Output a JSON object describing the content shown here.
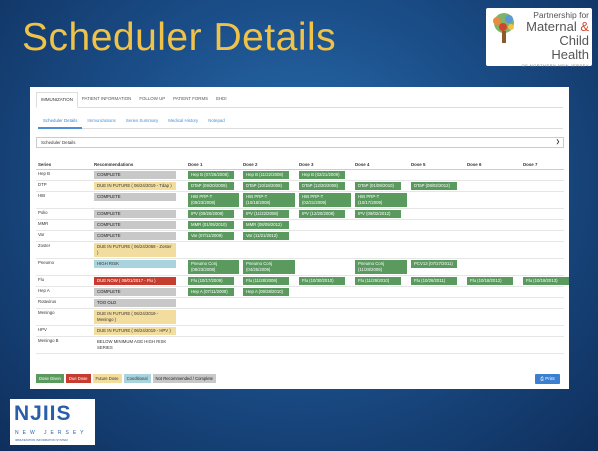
{
  "slide": {
    "title": "Scheduler Details"
  },
  "logo_pmch": {
    "line1": "Partnership for",
    "line2a": "Maternal ",
    "amp": "&",
    "line3": "Child Health",
    "line4": "OF NORTHERN NEW JERSEY"
  },
  "logo_njiis": {
    "title": "NJIIS",
    "sub": "NEW JERSEY",
    "small": "IMMUNIZATION INFORMATION SYSTEM"
  },
  "top_tabs": [
    "IMMUNIZATION",
    "PATIENT INFORMATION",
    "FOLLOW UP",
    "PATIENT FORMS",
    "EHDI"
  ],
  "sub_tabs": [
    "Scheduler Details",
    "Immunizations",
    "Series Summary",
    "Medical History",
    "Notepad"
  ],
  "dropdown": {
    "value": "Scheduler Details"
  },
  "table": {
    "headers": [
      "Series",
      "Recommendations",
      "Dose 1",
      "Dose 2",
      "Dose 3",
      "Dose 4",
      "Dose 5",
      "Dose 6",
      "Dose 7"
    ],
    "rows": [
      {
        "series": "Hep B",
        "rec": "COMPLETE",
        "rec_color": "gray",
        "doses": [
          "Hep B (07/26/2008)",
          "Hep B (11/22/2008)",
          "Hep B (02/21/2009)",
          "",
          "",
          "",
          ""
        ],
        "dose_colors": [
          "green",
          "green",
          "green",
          "",
          "",
          "",
          ""
        ]
      },
      {
        "series": "DTP",
        "rec": "DUE IN FUTURE ( 06/24/2019 - Tdap )",
        "rec_color": "yellow",
        "doses": [
          "DTaP (09/20/2008)",
          "DTaP (10/18/2008)",
          "DTaP (12/20/2008)",
          "DTaP (01/09/2010)",
          "DTaP (08/02/2012)",
          "",
          ""
        ],
        "dose_colors": [
          "green",
          "green",
          "green",
          "green",
          "green",
          "",
          ""
        ]
      },
      {
        "series": "HIB",
        "rec": "COMPLETE",
        "rec_color": "gray",
        "doses": [
          "HIB PRP-T (09/23/2008)",
          "HIB PRP-T (10/18/2008)",
          "HIB PRP-T (02/21/2009)",
          "HIB PRP-T (10/17/2009)",
          "",
          "",
          ""
        ],
        "dose_colors": [
          "green",
          "green",
          "green",
          "green",
          "",
          "",
          ""
        ]
      },
      {
        "series": "Polio",
        "rec": "COMPLETE",
        "rec_color": "gray",
        "doses": [
          "IPV (09/20/2008)",
          "IPV (11/22/2008)",
          "IPV (12/20/2008)",
          "IPV (08/02/2012)",
          "",
          "",
          ""
        ],
        "dose_colors": [
          "green",
          "green",
          "green",
          "green",
          "",
          "",
          ""
        ]
      },
      {
        "series": "MMR",
        "rec": "COMPLETE",
        "rec_color": "gray",
        "doses": [
          "MMR (01/09/2010)",
          "MMR (08/09/2012)",
          "",
          "",
          "",
          "",
          ""
        ],
        "dose_colors": [
          "green",
          "green",
          "",
          "",
          "",
          "",
          ""
        ]
      },
      {
        "series": "Var",
        "rec": "COMPLETE",
        "rec_color": "gray",
        "doses": [
          "Var (07/11/2009)",
          "Var (11/21/2012)",
          "",
          "",
          "",
          "",
          ""
        ],
        "dose_colors": [
          "green",
          "green",
          "",
          "",
          "",
          "",
          ""
        ]
      },
      {
        "series": "Zoster",
        "rec": "DUE IN FUTURE ( 06/24/2068 - Zoster )",
        "rec_color": "yellow",
        "doses": [
          "",
          "",
          "",
          "",
          "",
          "",
          ""
        ],
        "dose_colors": [
          "",
          "",
          "",
          "",
          "",
          "",
          ""
        ]
      },
      {
        "series": "Pneumo",
        "rec": "HIGH RISK",
        "rec_color": "blue",
        "doses": [
          "Pneumo Conj (08/23/2008)",
          "Pneumo Conj (04/25/2009)",
          "",
          "Pneumo Conj (11/28/2009)",
          "PCV13 (07/27/2011)",
          "",
          ""
        ],
        "dose_colors": [
          "green",
          "green",
          "",
          "green",
          "green",
          "",
          ""
        ]
      },
      {
        "series": "Flu",
        "rec": "DUE NOW ( 08/01/2017 - Flu )",
        "rec_color": "red",
        "doses": [
          "Flu (10/17/2009)",
          "Flu (11/28/2009)",
          "Flu (10/30/2010)",
          "Flu (11/29/2010)",
          "Flu (10/26/2011)",
          "Flu (10/18/2012)",
          "Flu (10/19/2013)"
        ],
        "dose_colors": [
          "green",
          "green",
          "green",
          "green",
          "green",
          "green",
          "green"
        ]
      },
      {
        "series": "Hep A",
        "rec": "COMPLETE",
        "rec_color": "gray",
        "doses": [
          "Hep A (07/11/2009)",
          "Hep A (09/28/2010)",
          "",
          "",
          "",
          "",
          ""
        ],
        "dose_colors": [
          "green",
          "green",
          "",
          "",
          "",
          "",
          ""
        ]
      },
      {
        "series": "Rotavirus",
        "rec": "TOO OLD",
        "rec_color": "gray",
        "doses": [
          "",
          "",
          "",
          "",
          "",
          "",
          ""
        ],
        "dose_colors": [
          "",
          "",
          "",
          "",
          "",
          "",
          ""
        ]
      },
      {
        "series": "Meningo",
        "rec": "DUE IN FUTURE ( 06/24/2019 - Meningo )",
        "rec_color": "yellow",
        "doses": [
          "",
          "",
          "",
          "",
          "",
          "",
          ""
        ],
        "dose_colors": [
          "",
          "",
          "",
          "",
          "",
          "",
          ""
        ]
      },
      {
        "series": "HPV",
        "rec": "DUE IN FUTURE ( 06/24/2019 - HPV )",
        "rec_color": "yellow",
        "doses": [
          "",
          "",
          "",
          "",
          "",
          "",
          ""
        ],
        "dose_colors": [
          "",
          "",
          "",
          "",
          "",
          "",
          ""
        ]
      },
      {
        "series": "Meningo B",
        "rec": "BELOW MINIMUM AGE HIGH RISK SERIES",
        "rec_color": "none",
        "doses": [
          "",
          "",
          "",
          "",
          "",
          "",
          ""
        ],
        "dose_colors": [
          "",
          "",
          "",
          "",
          "",
          "",
          ""
        ]
      }
    ]
  },
  "legend": [
    {
      "label": "Dose Given",
      "color": "green"
    },
    {
      "label": "Due Dose",
      "color": "red"
    },
    {
      "label": "Future Dose",
      "color": "yellow"
    },
    {
      "label": "Conditional",
      "color": "blue"
    },
    {
      "label": "Not Recommended / Complete",
      "color": "gray"
    }
  ],
  "print_button": {
    "label": "Print",
    "icon": "printer-icon"
  }
}
